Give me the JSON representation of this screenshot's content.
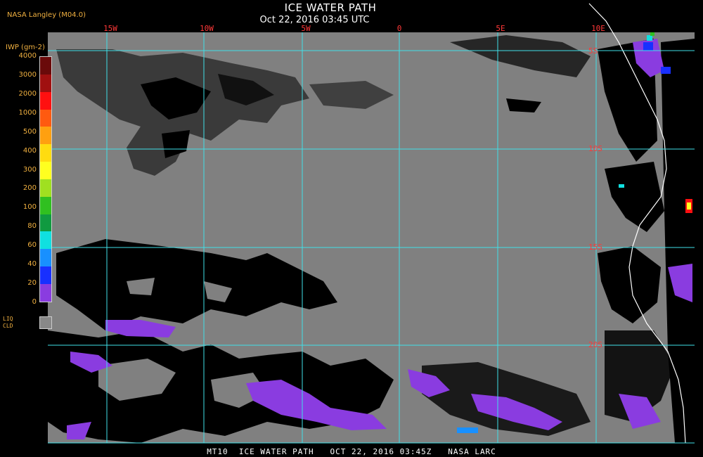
{
  "header": {
    "title": "ICE WATER PATH",
    "subtitle": "Oct 22, 2016 03:45 UTC",
    "credit": "NASA Langley (M04.0)"
  },
  "map": {
    "lon_labels": [
      "15W",
      "10W",
      "5W",
      "0",
      "5E",
      "10E"
    ],
    "lat_labels": [
      "5S",
      "10S",
      "15S",
      "20S"
    ],
    "grid_color": "#40e0e8",
    "label_color": "#ff3838",
    "cloud_liquid_color": "#808080",
    "clear_color": "#000000",
    "ice_color": "#8a3ce0"
  },
  "legend": {
    "title": "IWP (gm-2)",
    "ticks": [
      "4000",
      "3000",
      "2000",
      "1000",
      "500",
      "400",
      "300",
      "200",
      "100",
      "80",
      "60",
      "40",
      "20",
      "0"
    ],
    "colors": [
      "#6a0a0a",
      "#a01010",
      "#ff1010",
      "#ff5a10",
      "#ffa010",
      "#ffdc10",
      "#ffff20",
      "#a0e020",
      "#30c020",
      "#109a40",
      "#10e0e0",
      "#1890ff",
      "#1830ff",
      "#8a3ce0"
    ],
    "liq_line1": "LIQ",
    "liq_line2": "CLD"
  },
  "footer": {
    "text": "MT10  ICE WATER PATH   OCT 22, 2016 03:45Z   NASA LARC"
  }
}
